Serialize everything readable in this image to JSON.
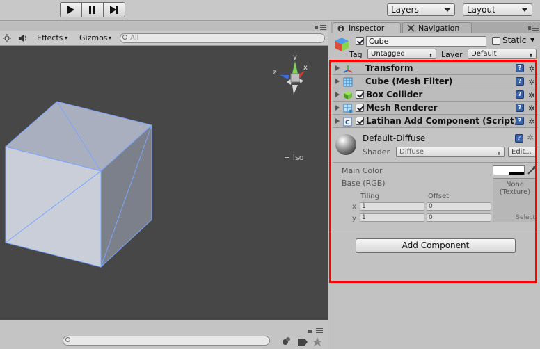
{
  "toolbar": {
    "layers_label": "Layers",
    "layout_label": "Layout"
  },
  "scene": {
    "effects_label": "Effects",
    "gizmos_label": "Gizmos",
    "search_placeholder": "All",
    "iso_label": "Iso",
    "axis_labels": {
      "x": "x",
      "y": "y",
      "z": "z"
    }
  },
  "inspector": {
    "tab_inspector": "Inspector",
    "tab_navigation": "Navigation",
    "object_name": "Cube",
    "static_label": "Static",
    "tag_label": "Tag",
    "tag_value": "Untagged",
    "layer_label": "Layer",
    "layer_value": "Default",
    "components": [
      {
        "label": "Transform",
        "icon": "transform-icon",
        "has_checkbox": false
      },
      {
        "label": "Cube (Mesh Filter)",
        "icon": "mesh-filter-icon",
        "has_checkbox": false
      },
      {
        "label": "Box Collider",
        "icon": "box-collider-icon",
        "has_checkbox": true
      },
      {
        "label": "Mesh Renderer",
        "icon": "mesh-renderer-icon",
        "has_checkbox": true
      },
      {
        "label": "Latihan Add Component (Script)",
        "icon": "script-icon",
        "has_checkbox": true
      }
    ],
    "material": {
      "name": "Default-Diffuse",
      "shader_label": "Shader",
      "shader_value": "Diffuse",
      "edit_label": "Edit...",
      "main_color_label": "Main Color",
      "base_label": "Base (RGB)",
      "tiling_label": "Tiling",
      "offset_label": "Offset",
      "x_label": "x",
      "y_label": "y",
      "tiling_x": "1",
      "tiling_y": "1",
      "offset_x": "0",
      "offset_y": "0",
      "texture_none": "None",
      "texture_type": "(Texture)",
      "select_label": "Select"
    },
    "add_component_label": "Add Component"
  },
  "colors": {
    "highlight": "#ff0000",
    "scene_bg": "#474747",
    "cube_face": "#c7ccd6",
    "wire": "#7aa6ff"
  }
}
